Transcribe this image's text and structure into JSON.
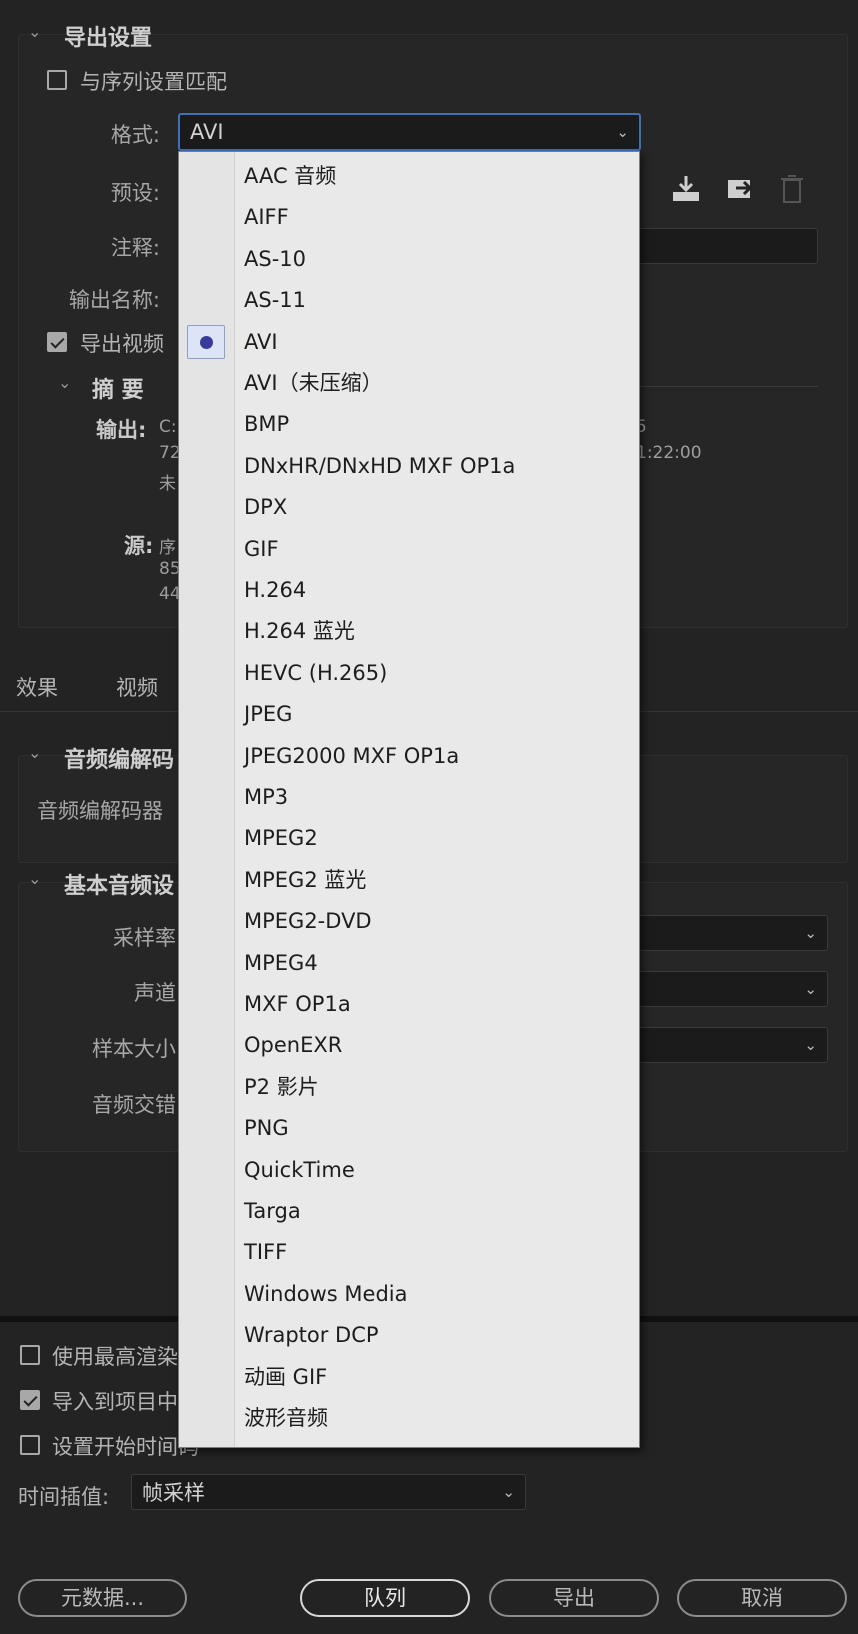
{
  "export_settings": {
    "header": "导出设置",
    "match_sequence_label": "与序列设置匹配",
    "format_label": "格式:",
    "format_value": "AVI",
    "preset_label": "预设:",
    "comment_label": "注释:",
    "output_name_label": "输出名称:",
    "export_video_label": "导出视频"
  },
  "summary": {
    "header": "摘 要",
    "output_label": "输出:",
    "output_lines": [
      "C:",
      "72",
      "未"
    ],
    "output_right": [
      "5",
      "1:22:00"
    ],
    "source_label": "源:",
    "source_lines": [
      "序",
      "85",
      "44"
    ]
  },
  "tabs": [
    "效果",
    "视频"
  ],
  "audio_codec": {
    "header": "音频编解码",
    "codec_label": "音频编解码器"
  },
  "basic_audio": {
    "header": "基本音频设",
    "sample_rate_label": "采样率",
    "channels_label": "声道",
    "sample_size_label": "样本大小",
    "interleave_label": "音频交错"
  },
  "bottom": {
    "max_render_label": "使用最高渲染",
    "import_project_label": "导入到项目中",
    "set_start_time_label": "设置开始时间码",
    "time_interp_label": "时间插值:",
    "time_interp_value": "帧采样",
    "metadata_button": "元数据...",
    "queue_button": "队列",
    "export_button": "导出",
    "cancel_button": "取消"
  },
  "format_menu": {
    "selected": "AVI",
    "items": [
      "AAC 音频",
      "AIFF",
      "AS-10",
      "AS-11",
      "AVI",
      "AVI（未压缩）",
      "BMP",
      "DNxHR/DNxHD MXF OP1a",
      "DPX",
      "GIF",
      "H.264",
      "H.264 蓝光",
      "HEVC (H.265)",
      "JPEG",
      "JPEG2000 MXF OP1a",
      "MP3",
      "MPEG2",
      "MPEG2 蓝光",
      "MPEG2-DVD",
      "MPEG4",
      "MXF OP1a",
      "OpenEXR",
      "P2 影片",
      "PNG",
      "QuickTime",
      "Targa",
      "TIFF",
      "Windows Media",
      "Wraptor DCP",
      "动画 GIF",
      "波形音频"
    ]
  },
  "icons": [
    "chevron-down-icon",
    "import-preset-icon",
    "save-preset-icon",
    "delete-preset-icon",
    "checkbox-icon",
    "radio-selected-icon"
  ]
}
